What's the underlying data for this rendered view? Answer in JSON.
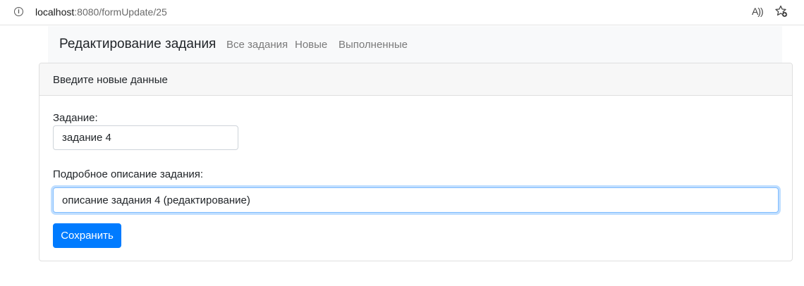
{
  "browser": {
    "url_host": "localhost",
    "url_rest": ":8080/formUpdate/25",
    "info_icon": "info-icon",
    "read_aloud_icon": "read-aloud-icon",
    "read_aloud_glyph": "A))",
    "favorites_icon": "add-favorite-icon"
  },
  "navbar": {
    "brand": "Редактирование задания",
    "links": [
      {
        "label": "Все задания"
      },
      {
        "label": "Новые"
      },
      {
        "label": "Выполненные"
      }
    ]
  },
  "card": {
    "header": "Введите новые данные",
    "fields": [
      {
        "label": "Задание:",
        "value": "задание 4"
      },
      {
        "label": "Подробное описание задания:",
        "value": "описание задания 4 (редактирование)"
      }
    ],
    "submit_label": "Сохранить"
  },
  "colors": {
    "primary": "#007bff",
    "navbar_bg": "#f8f9fa",
    "focus_border": "#80bdff"
  }
}
